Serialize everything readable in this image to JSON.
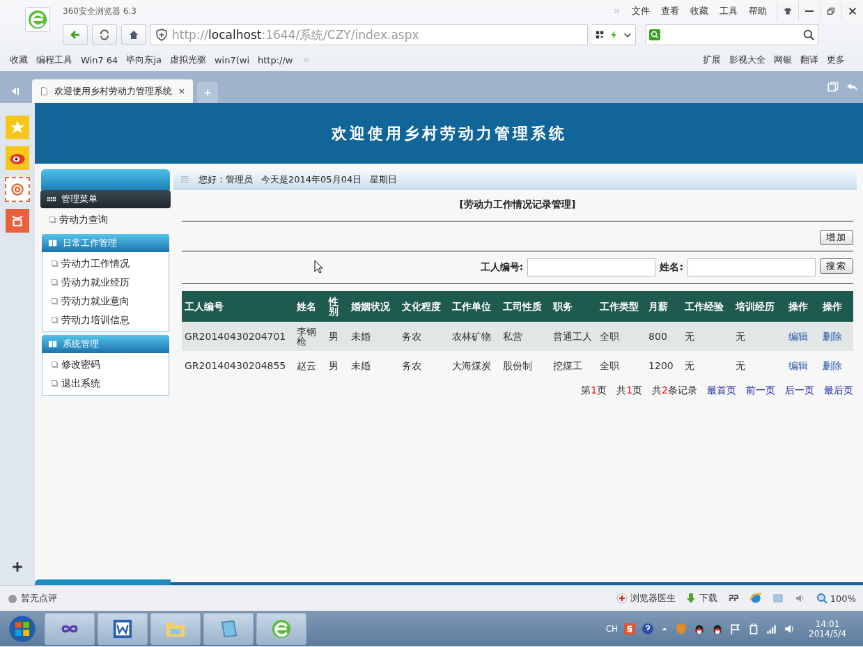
{
  "browser": {
    "title": "360安全浏览器 6.3",
    "menu": [
      "文件",
      "查看",
      "收藏",
      "工具",
      "帮助"
    ],
    "url": "http://**localhost**:1644/系统/CZY/index.aspx",
    "bookmarks": [
      "收藏",
      "编程工具",
      "Win7 64",
      "毕向东ja",
      "虚拟光驱",
      "win7(wi",
      "http://w"
    ],
    "bookmarks_right": [
      "扩展",
      "影视大全",
      "网银",
      "翻译",
      "更多"
    ],
    "tabs": [
      {
        "label": "欢迎使用乡村劳动力管理系统",
        "selected": true
      }
    ]
  },
  "page": {
    "header": "欢迎使用乡村劳动力管理系统",
    "greeting": "您好：管理员",
    "date": "今天是2014年05月04日",
    "weekday": "星期日",
    "sidebar": [
      {
        "title": "管理菜单",
        "kind": "dark",
        "items": [
          "劳动力查询"
        ]
      },
      {
        "title": "日常工作管理",
        "kind": "blue",
        "items": [
          "劳动力工作情况",
          "劳动力就业经历",
          "劳动力就业意向",
          "劳动力培训信息"
        ]
      },
      {
        "title": "系统管理",
        "kind": "blue",
        "items": [
          "修改密码",
          "退出系统"
        ]
      }
    ],
    "section_title": "[劳动力工作情况记录管理]",
    "add_button": "增加",
    "search": {
      "id_label": "工人编号:",
      "name_label": "姓名:",
      "button": "搜索"
    },
    "table": {
      "columns": [
        "工人编号",
        "姓名",
        "性别",
        "婚姻状况",
        "文化程度",
        "工作单位",
        "工司性质",
        "职务",
        "工作类型",
        "月薪",
        "工作经验",
        "培训经历",
        "操作",
        "操作"
      ],
      "rows": [
        {
          "cells": [
            "GR20140430204701",
            "李钢枪",
            "男",
            "未婚",
            "务农",
            "农林矿物",
            "私营",
            "普通工人",
            "全职",
            "800",
            "无",
            "无"
          ],
          "actions": [
            "编辑",
            "删除"
          ]
        },
        {
          "cells": [
            "GR20140430204855",
            "赵云",
            "男",
            "未婚",
            "务农",
            "大海煤炭",
            "股份制",
            "挖煤工",
            "全职",
            "1200",
            "无",
            "无"
          ],
          "actions": [
            "编辑",
            "删除"
          ]
        }
      ]
    },
    "pager": {
      "info": [
        {
          "prefix": "第",
          "number": "1",
          "suffix": "页"
        },
        {
          "prefix": "共",
          "number": "1",
          "suffix": "页"
        },
        {
          "prefix": "共",
          "number": "2",
          "suffix": "条记录"
        }
      ],
      "links": [
        "最首页",
        "前一页",
        "后一页",
        "最后页"
      ]
    }
  },
  "status_bar": {
    "left": "暂无点评",
    "doctor": "浏览器医生",
    "download": "下载",
    "zoom": "100%"
  },
  "taskbar": {
    "ime": "CH",
    "time": "14:01",
    "date": "2014/5/4"
  }
}
